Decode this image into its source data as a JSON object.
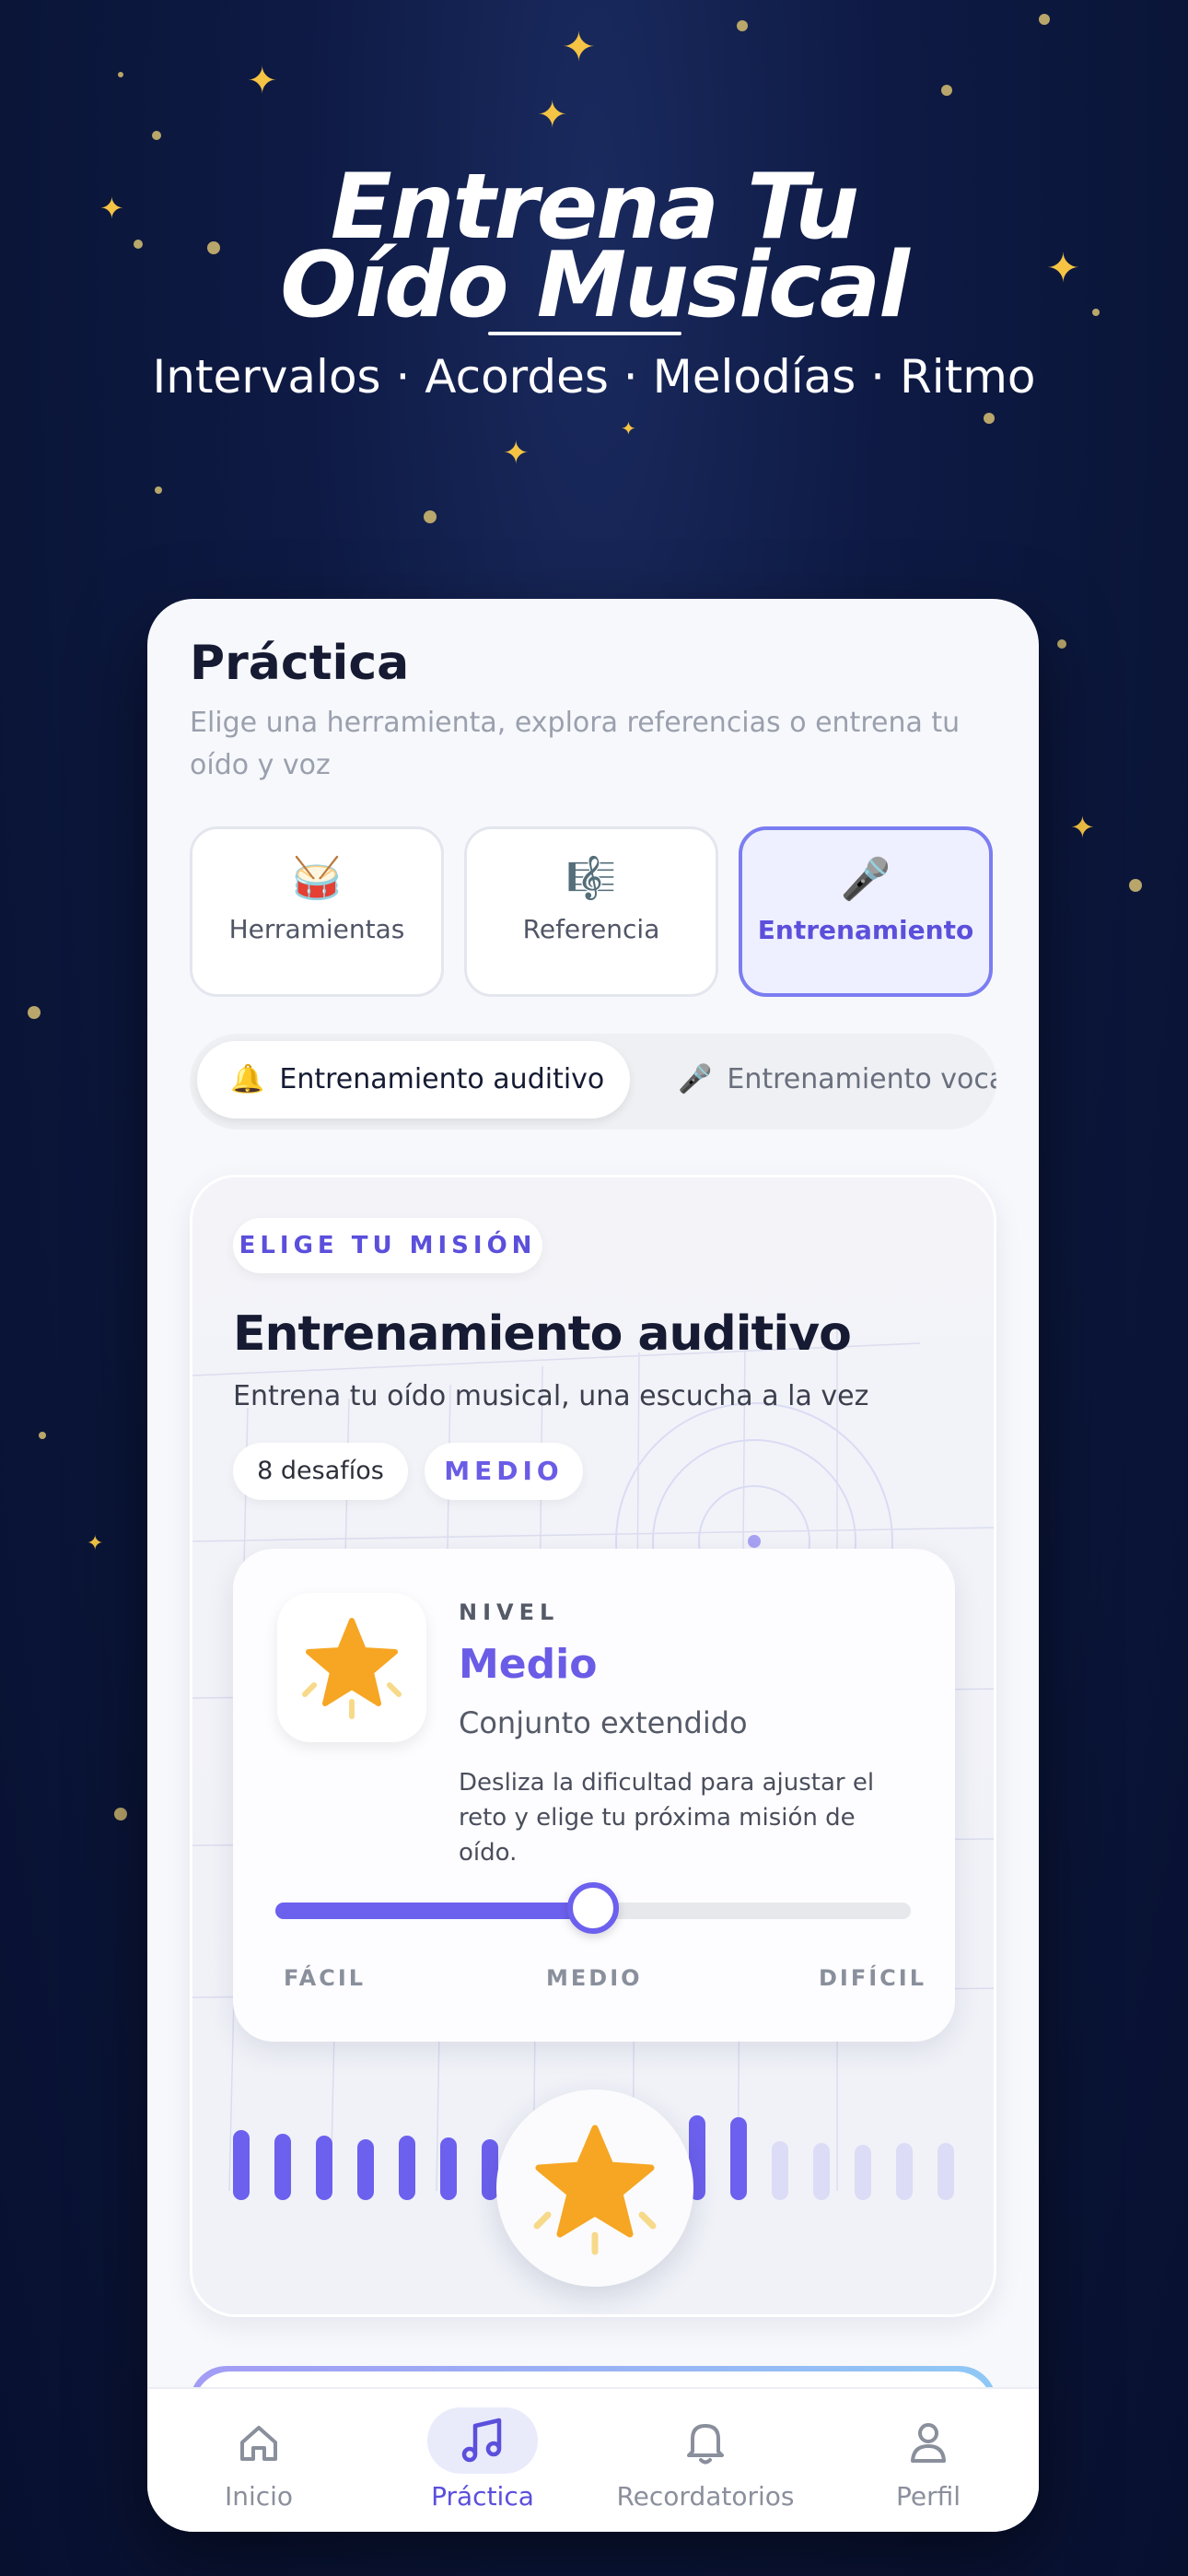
{
  "hero": {
    "title_line1": "Entrena Tu",
    "title_line2": "Oído Musical",
    "subtitle": "Intervalos · Acordes · Melodías · Ritmo"
  },
  "screen": {
    "title": "Práctica",
    "subtitle": "Elige una herramienta, explora referencias o entrena tu oído y voz",
    "segments": [
      {
        "label": "Herramientas",
        "icon": "drum-icon",
        "glyph": "🥁"
      },
      {
        "label": "Referencia",
        "icon": "sheet-music-icon",
        "glyph": "🎼"
      },
      {
        "label": "Entrenamiento",
        "icon": "microphone-icon",
        "glyph": "🎤",
        "active": true
      }
    ],
    "subtabs": [
      {
        "label": "Entrenamiento auditivo",
        "icon": "bell-icon",
        "glyph": "🔔",
        "active": true
      },
      {
        "label": "Entrenamiento vocal",
        "icon": "microphone-icon",
        "glyph": "🎤"
      }
    ]
  },
  "mission": {
    "label": "ELIGE TU MISIÓN",
    "title": "Entrenamiento auditivo",
    "description": "Entrena tu oído musical, una escucha a la vez",
    "challenges": "8 desafíos",
    "difficulty_chip": "MEDIO",
    "level": {
      "caption": "NIVEL",
      "name": "Medio",
      "set": "Conjunto extendido",
      "description": "Desliza la dificultad para ajustar el reto y elige tu próxima misión de oído.",
      "slider_value": 0.5,
      "ticks": [
        "FÁCIL",
        "MEDIO",
        "DIFÍCIL"
      ]
    },
    "waveform_active_fraction": 0.6,
    "accent_color": "#6c60ee",
    "star_color": "#f6a623"
  },
  "nav": {
    "items": [
      {
        "label": "Inicio",
        "icon": "home-icon"
      },
      {
        "label": "Práctica",
        "icon": "music-note-icon",
        "active": true
      },
      {
        "label": "Recordatorios",
        "icon": "bell-icon"
      },
      {
        "label": "Perfil",
        "icon": "user-icon"
      }
    ]
  }
}
